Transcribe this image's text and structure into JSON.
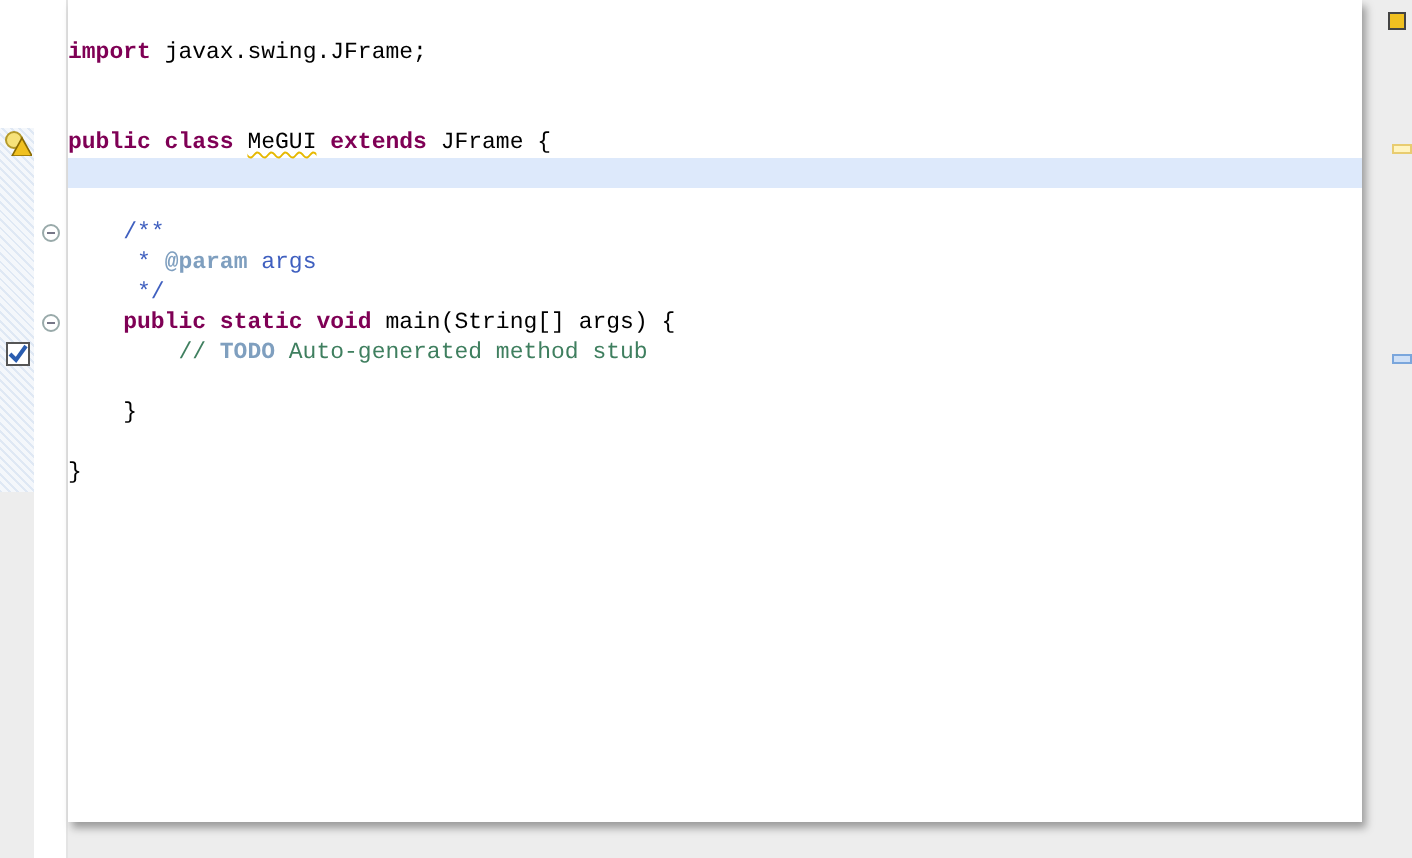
{
  "editor": {
    "lines": [
      {
        "current": false
      },
      {
        "tokens": [
          {
            "text": "import",
            "kind": "keyword"
          },
          {
            "text": "javax.swing.JFrame;",
            "kind": "plain"
          }
        ],
        "current": false
      },
      {
        "current": false
      },
      {
        "current": false
      },
      {
        "tokens": [
          {
            "text": "public class",
            "kind": "keyword"
          },
          {
            "text": "MeGUI",
            "kind": "plain",
            "warning": true
          },
          {
            "text": "extends",
            "kind": "keyword"
          },
          {
            "text": "JFrame {",
            "kind": "plain"
          }
        ],
        "current": false,
        "marker": {
          "kind": "warning"
        }
      },
      {
        "current": true
      },
      {
        "current": false
      },
      {
        "tokens": [
          {
            "text": "    /**",
            "kind": "javadoc"
          }
        ],
        "current": false,
        "fold": true
      },
      {
        "tokens": [
          {
            "text": "     *",
            "kind": "javadoc"
          },
          {
            "text": "@param",
            "kind": "javadoc-tag"
          },
          {
            "text": "args",
            "kind": "javadoc"
          }
        ],
        "current": false
      },
      {
        "tokens": [
          {
            "text": "     */",
            "kind": "javadoc"
          }
        ],
        "current": false
      },
      {
        "tokens": [
          {
            "text": "    public static void",
            "kind": "keyword"
          },
          {
            "text": "main(String[] args) {",
            "kind": "plain"
          }
        ],
        "current": false,
        "fold": true
      },
      {
        "tokens": [
          {
            "text": "        //",
            "kind": "comment"
          },
          {
            "text": "TODO",
            "kind": "todo"
          },
          {
            "text": "Auto-generated method stub",
            "kind": "comment"
          }
        ],
        "current": false,
        "marker": {
          "kind": "task"
        }
      },
      {
        "current": false
      },
      {
        "tokens": [
          {
            "text": "    }",
            "kind": "plain"
          }
        ],
        "current": false
      },
      {
        "current": false
      },
      {
        "tokens": [
          {
            "text": "}",
            "kind": "plain"
          }
        ],
        "current": false
      }
    ]
  }
}
